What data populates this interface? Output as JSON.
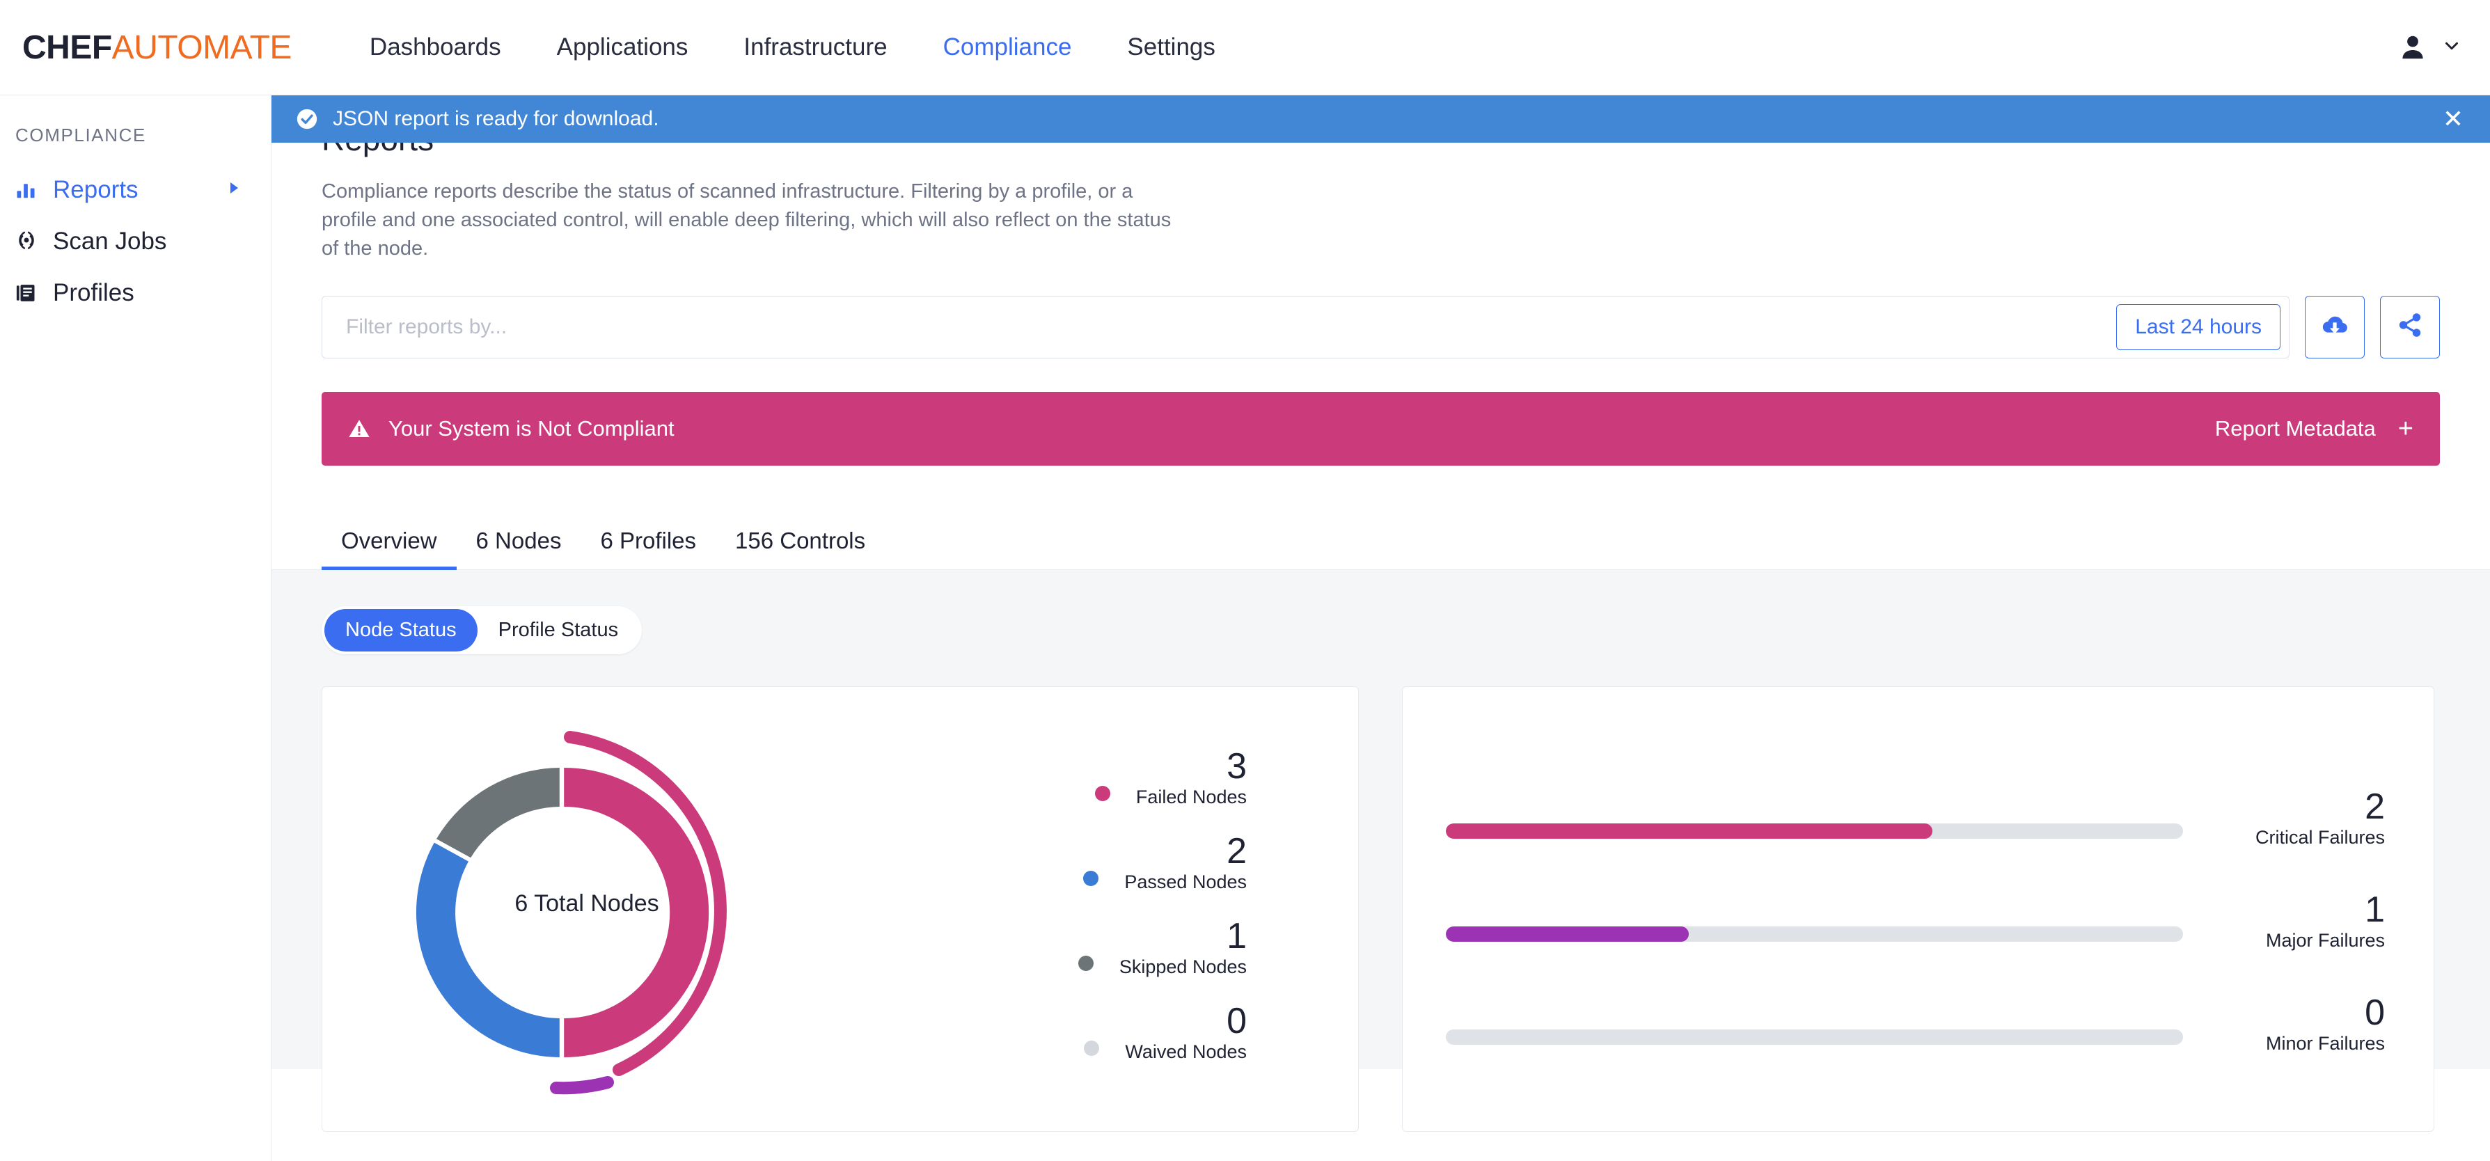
{
  "brand": {
    "part1": "CHEF",
    "part2": "AUTOMATE"
  },
  "topnav": {
    "items": [
      {
        "label": "Dashboards",
        "active": false
      },
      {
        "label": "Applications",
        "active": false
      },
      {
        "label": "Infrastructure",
        "active": false
      },
      {
        "label": "Compliance",
        "active": true
      },
      {
        "label": "Settings",
        "active": false
      }
    ],
    "user_icon": "user-icon",
    "chevron": "chevron-down-icon"
  },
  "sidebar": {
    "section_title": "COMPLIANCE",
    "items": [
      {
        "label": "Reports",
        "icon": "bar-chart-icon",
        "active": true,
        "has_arrow": true
      },
      {
        "label": "Scan Jobs",
        "icon": "target-icon",
        "active": false,
        "has_arrow": false
      },
      {
        "label": "Profiles",
        "icon": "book-icon",
        "active": false,
        "has_arrow": false
      }
    ]
  },
  "notification": {
    "message": "JSON report is ready for download.",
    "icon": "check-circle-icon",
    "close_icon": "close-icon",
    "bg_color": "#4287d6"
  },
  "page": {
    "title": "Reports",
    "description": "Compliance reports describe the status of scanned infrastructure. Filtering by a profile, or a profile and one associated control, will enable deep filtering, which will also reflect on the status of the node."
  },
  "filter": {
    "placeholder": "Filter reports by...",
    "value": "",
    "date_range_label": "Last 24 hours",
    "download_icon": "cloud-download-icon",
    "share_icon": "share-icon"
  },
  "alert": {
    "text": "Your System is Not Compliant",
    "icon": "warning-triangle-icon",
    "metadata_label": "Report Metadata",
    "expand_icon": "+",
    "bg_color": "#cb3b7b"
  },
  "tabs": [
    {
      "label": "Overview",
      "active": true
    },
    {
      "label": "6 Nodes",
      "active": false
    },
    {
      "label": "6 Profiles",
      "active": false
    },
    {
      "label": "156 Controls",
      "active": false
    }
  ],
  "status_toggle": [
    {
      "label": "Node Status",
      "active": true
    },
    {
      "label": "Profile Status",
      "active": false
    }
  ],
  "chart_data": [
    {
      "type": "pie",
      "title": "6 Total Nodes",
      "center_label": "6 Total Nodes",
      "total": 6,
      "categories": [
        "Failed Nodes",
        "Passed Nodes",
        "Skipped Nodes",
        "Waived Nodes"
      ],
      "values": [
        3,
        2,
        1,
        0
      ],
      "colors": [
        "#cb3b7b",
        "#3a7bd5",
        "#6d7478",
        "#d4d8de"
      ],
      "legend_position": "right",
      "outer_ring": {
        "categories": [
          "Critical Failures",
          "Major Failures"
        ],
        "values": [
          2,
          1
        ],
        "colors": [
          "#cb3b7b",
          "#9c33b5"
        ]
      }
    },
    {
      "type": "bar",
      "title": "",
      "orientation": "horizontal",
      "categories": [
        "Critical Failures",
        "Major Failures",
        "Minor Failures"
      ],
      "values": [
        2,
        1,
        0
      ],
      "percents": [
        66,
        33,
        0
      ],
      "colors": [
        "#cb3b7b",
        "#9c33b5",
        "#dfe3e8"
      ],
      "xlabel": "",
      "ylabel": "",
      "grid": false
    }
  ],
  "donut_legend": [
    {
      "count": "3",
      "label": "Failed Nodes",
      "color": "#cb3b7b"
    },
    {
      "count": "2",
      "label": "Passed Nodes",
      "color": "#3a7bd5"
    },
    {
      "count": "1",
      "label": "Skipped Nodes",
      "color": "#6d7478"
    },
    {
      "count": "0",
      "label": "Waived Nodes",
      "color": "#d4d8de"
    }
  ],
  "failure_bars": [
    {
      "count": "2",
      "label": "Critical Failures",
      "percent": 66,
      "color": "#cb3b7b"
    },
    {
      "count": "1",
      "label": "Major Failures",
      "percent": 33,
      "color": "#9c33b5"
    },
    {
      "count": "0",
      "label": "Minor Failures",
      "percent": 0,
      "color": "#dfe3e8"
    }
  ],
  "theme": {
    "accent": "#3a6df0",
    "brand_orange": "#f06b20",
    "danger": "#cb3b7b",
    "info": "#4287d6"
  }
}
